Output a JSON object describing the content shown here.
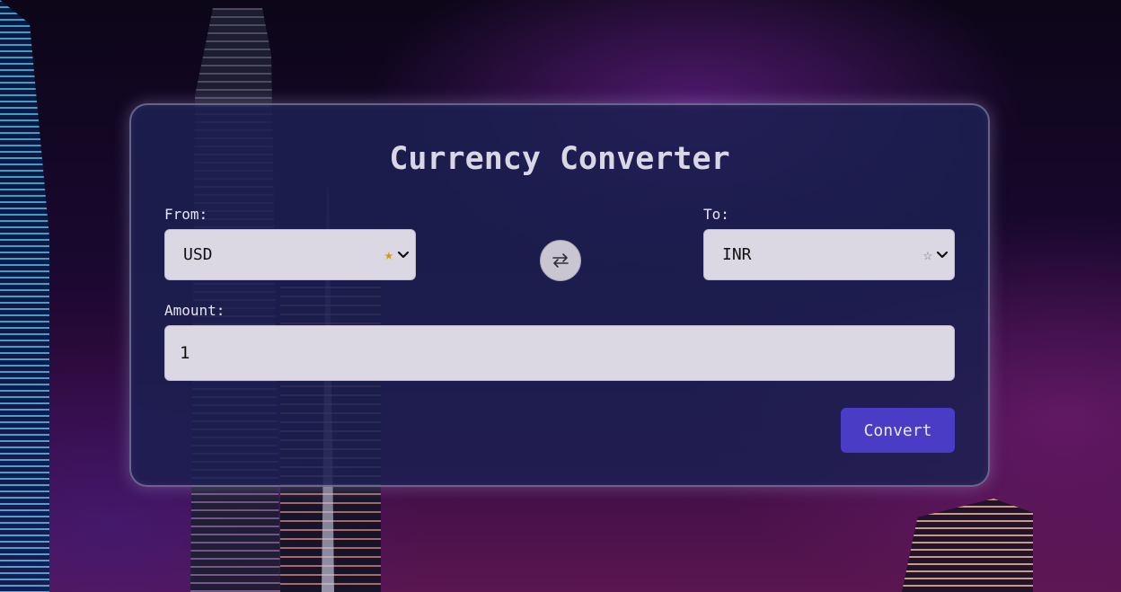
{
  "app": {
    "title": "Currency Converter"
  },
  "from": {
    "label": "From:",
    "value": "USD",
    "favorite": true
  },
  "to": {
    "label": "To:",
    "value": "INR",
    "favorite": false
  },
  "amount": {
    "label": "Amount:",
    "value": "1"
  },
  "actions": {
    "convert_label": "Convert",
    "swap_icon": "swap-arrows-icon"
  },
  "colors": {
    "accent": "#4b3cc6",
    "star_filled": "#d49a1a",
    "card_bg": "#1c2052"
  }
}
